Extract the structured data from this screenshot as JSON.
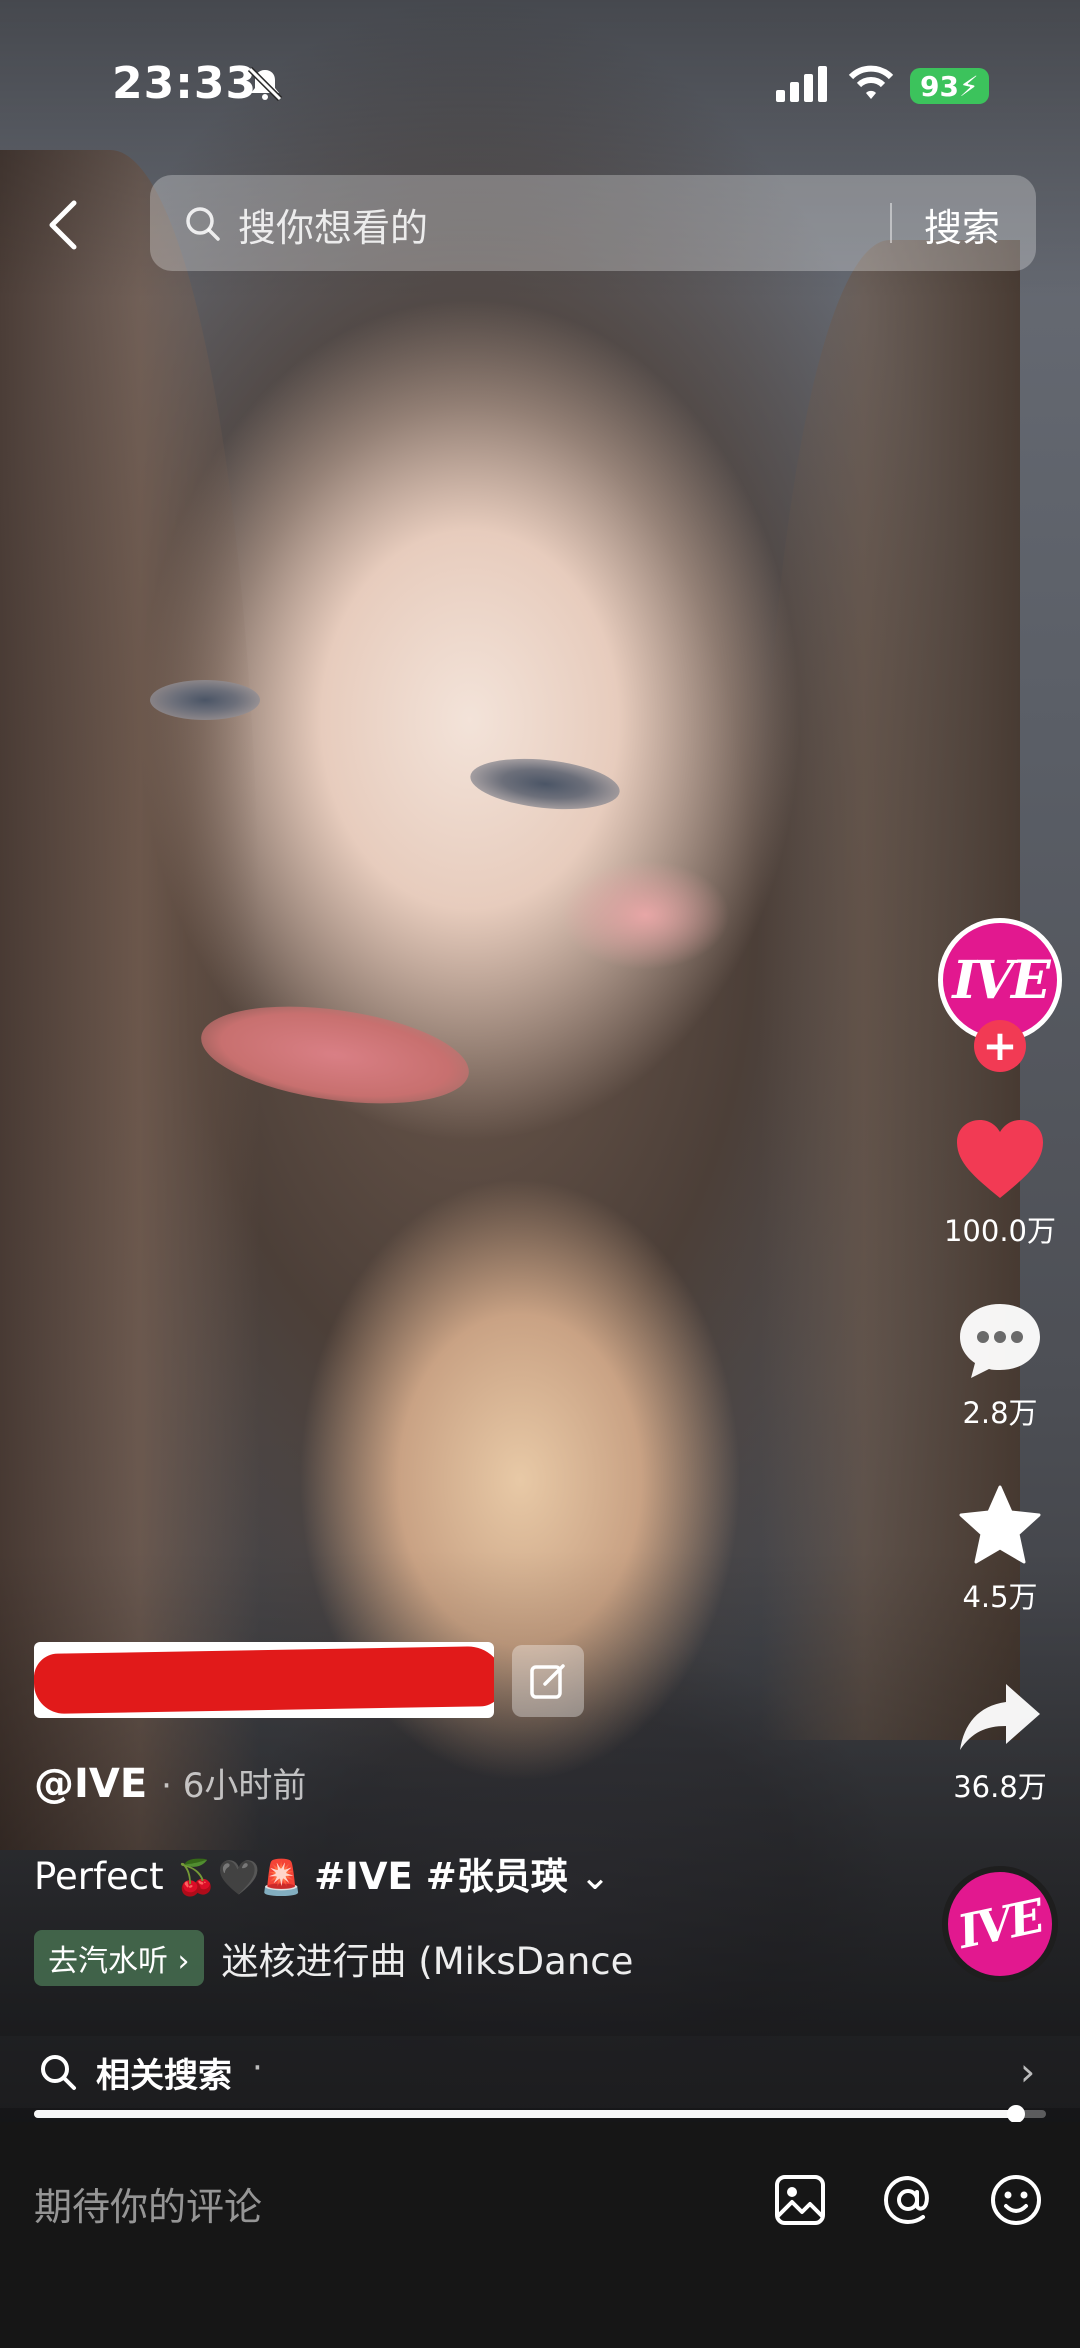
{
  "status_bar": {
    "time": "23:33",
    "battery": "93"
  },
  "search": {
    "placeholder": "搜你想看的",
    "button": "搜索"
  },
  "account": {
    "avatar_text": "IVE",
    "follow_label": "+"
  },
  "actions": {
    "likes": "100.0万",
    "comments": "2.8万",
    "favorites": "4.5万",
    "shares": "36.8万"
  },
  "post": {
    "author": "@IVE",
    "posted": "· 6小时前",
    "caption_text": "Perfect",
    "caption_emoji": "🍒🖤🚨",
    "caption_tags": "#IVE #张员瑛",
    "music_chip": "去汽水听 ›",
    "music_title": "迷核进行曲 (MiksDance"
  },
  "related": {
    "label": "相关搜索",
    "dot": "·"
  },
  "progress": 0.97,
  "comment_bar": {
    "placeholder": "期待你的评论"
  },
  "colors": {
    "brand_pink": "#e2188f",
    "like_red": "#f23a54",
    "battery_green": "#3cc35c"
  },
  "icons": [
    "back-icon",
    "search-icon",
    "heart-icon",
    "comment-icon",
    "star-icon",
    "share-icon",
    "edit-icon",
    "image-icon",
    "at-icon",
    "emoji-icon",
    "chevron-right-icon"
  ]
}
